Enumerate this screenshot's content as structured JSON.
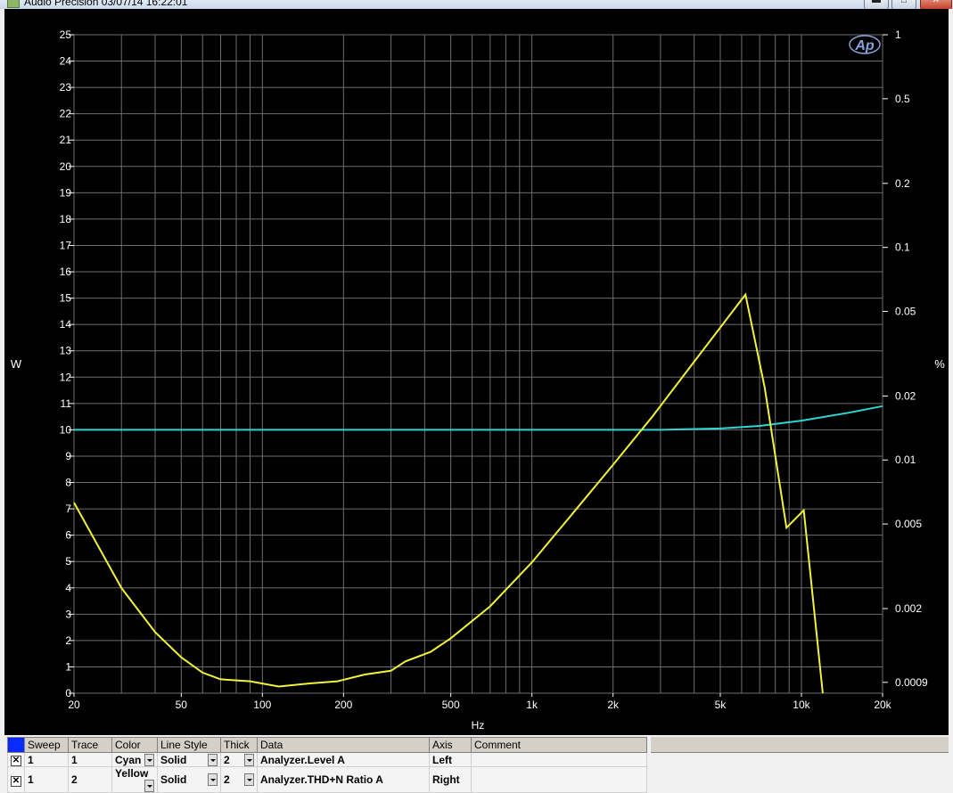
{
  "window": {
    "title": "Audio Precision  03/07/14 16:22:01",
    "min_glyph": "▬",
    "max_glyph": "□",
    "close_glyph": "✕"
  },
  "colors": {
    "background": "#000000",
    "grid": "#6e6e6e",
    "axis_text": "#ffffff",
    "cyan": "#2ed6d6",
    "yellow": "#f2f23a"
  },
  "chart_data": {
    "type": "line",
    "xlabel": "Hz",
    "ylabel_left": "W",
    "ylabel_right": "%",
    "x_scale": "log",
    "xlim": [
      20,
      20000
    ],
    "ylim_left": [
      0,
      25
    ],
    "ylim_right": [
      0.0008,
      1
    ],
    "y_right_scale": "log",
    "grid": true,
    "x_ticks": [
      {
        "value": 20,
        "label": "20"
      },
      {
        "value": 50,
        "label": "50"
      },
      {
        "value": 100,
        "label": "100"
      },
      {
        "value": 200,
        "label": "200"
      },
      {
        "value": 500,
        "label": "500"
      },
      {
        "value": 1000,
        "label": "1k"
      },
      {
        "value": 2000,
        "label": "2k"
      },
      {
        "value": 5000,
        "label": "5k"
      },
      {
        "value": 10000,
        "label": "10k"
      },
      {
        "value": 20000,
        "label": "20k"
      }
    ],
    "y_left_ticks": [
      "0",
      "1",
      "2",
      "3",
      "4",
      "5",
      "6",
      "7",
      "8",
      "9",
      "10",
      "11",
      "12",
      "13",
      "14",
      "15",
      "16",
      "17",
      "18",
      "19",
      "20",
      "21",
      "22",
      "23",
      "24",
      "25"
    ],
    "y_right_ticks": [
      {
        "value": 1,
        "label": "1"
      },
      {
        "value": 0.5,
        "label": "0.5"
      },
      {
        "value": 0.2,
        "label": "0.2"
      },
      {
        "value": 0.1,
        "label": "0.1"
      },
      {
        "value": 0.05,
        "label": "0.05"
      },
      {
        "value": 0.02,
        "label": "0.02"
      },
      {
        "value": 0.01,
        "label": "0.01"
      },
      {
        "value": 0.005,
        "label": "0.005"
      },
      {
        "value": 0.002,
        "label": "0.002"
      },
      {
        "value": 0.0009,
        "label": "0.0009"
      }
    ],
    "series": [
      {
        "axis": "left",
        "color": "#2ed6d6",
        "x": [
          20,
          100,
          1000,
          3000,
          5000,
          7000,
          10000,
          15000,
          20000
        ],
        "y": [
          10.0,
          10.0,
          10.0,
          10.0,
          10.05,
          10.15,
          10.35,
          10.65,
          10.9
        ]
      },
      {
        "axis": "right",
        "color": "#f2f23a",
        "x": [
          20,
          30,
          40,
          50,
          60,
          70,
          90,
          115,
          150,
          190,
          240,
          300,
          340,
          420,
          500,
          700,
          1000,
          1400,
          2000,
          2800,
          4000,
          6200,
          7300,
          8800,
          10200,
          12000
        ],
        "y": [
          0.0063,
          0.0025,
          0.00155,
          0.00118,
          0.001,
          0.00093,
          0.00091,
          0.00086,
          0.00089,
          0.00091,
          0.00098,
          0.00102,
          0.00113,
          0.00125,
          0.00145,
          0.00205,
          0.0033,
          0.0055,
          0.0095,
          0.016,
          0.029,
          0.06,
          0.022,
          0.0048,
          0.0058,
          0.00075
        ]
      }
    ],
    "logo": "Ap"
  },
  "legend": {
    "headers": [
      "Sweep",
      "Trace",
      "Color",
      "Line Style",
      "Thick",
      "Data",
      "Axis",
      "Comment"
    ],
    "rows": [
      {
        "check": "✕",
        "sweep": "1",
        "trace": "1",
        "color": "Cyan",
        "style": "Solid",
        "thick": "2",
        "data": "Analyzer.Level A",
        "axis": "Left",
        "comment": ""
      },
      {
        "check": "✕",
        "sweep": "1",
        "trace": "2",
        "color": "Yellow",
        "style": "Solid",
        "thick": "2",
        "data": "Analyzer.THD+N Ratio A",
        "axis": "Right",
        "comment": ""
      }
    ]
  }
}
